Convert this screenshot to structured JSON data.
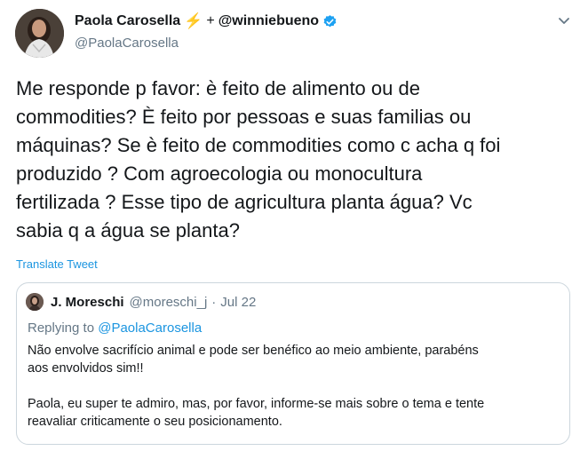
{
  "tweet": {
    "author_name": "Paola Carosella",
    "collab_plus": "+",
    "collab_name": "@winniebueno",
    "handle": "@PaolaCarosella",
    "text": "Me responde p favor: è feito de alimento ou de\ncommodities? È feito por pessoas e suas familias ou\nmáquinas? Se è feito de commodities como c acha q foi\nproduzido ? Com agroecologia ou monocultura\nfertilizada ? Esse tipo de agricultura planta água? Vc\nsabia q a água se planta?",
    "translate_label": "Translate Tweet",
    "icons": {
      "bolt": "lightning-icon",
      "verified": "verified-badge-icon",
      "menu": "chevron-down-icon"
    }
  },
  "quoted": {
    "author_name": "J. Moreschi",
    "handle": "@moreschi_j",
    "separator": "·",
    "date": "Jul 22",
    "reply_prefix": "Replying to",
    "reply_mention": "@PaolaCarosella",
    "text": "Não envolve sacrifício animal e pode ser benéfico ao meio ambiente, parabéns\naos envolvidos sim!!\n\nPaola, eu super te admiro, mas, por favor, informe-se mais sobre o tema e tente\nreavaliar criticamente o seu posicionamento."
  },
  "colors": {
    "link": "#1b95e0",
    "muted": "#657786",
    "border": "#ccd6dd",
    "bolt": "#f4b400"
  }
}
